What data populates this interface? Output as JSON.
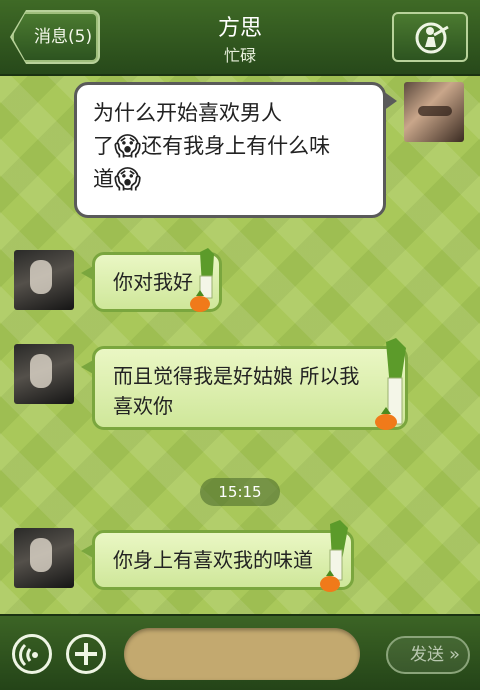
{
  "header": {
    "back_label": "消息(5)",
    "title": "方思",
    "subtitle": "忙碌",
    "profile_icon": "person-with-bat-icon"
  },
  "messages": [
    {
      "side": "right",
      "line1": "为什么开始喜欢男人",
      "line2_pre": "了",
      "line2_post": "还有我身上有什么味",
      "line3": "道",
      "emoji": "😱"
    },
    {
      "side": "left",
      "text": "你对我好"
    },
    {
      "side": "left",
      "line1": "而且觉得我是好姑娘 所以我",
      "line2": "喜欢你"
    },
    {
      "side": "left",
      "text": "你身上有喜欢我的味道"
    }
  ],
  "timestamp": "15:15",
  "bottom": {
    "voice_icon": "voice-icon",
    "add_icon": "plus-icon",
    "send_label": "发送"
  },
  "colors": {
    "header_green": "#2f5420",
    "background_green": "#a9c85a",
    "left_bubble": "#d8ecaa",
    "input_box": "#c3a96f"
  }
}
